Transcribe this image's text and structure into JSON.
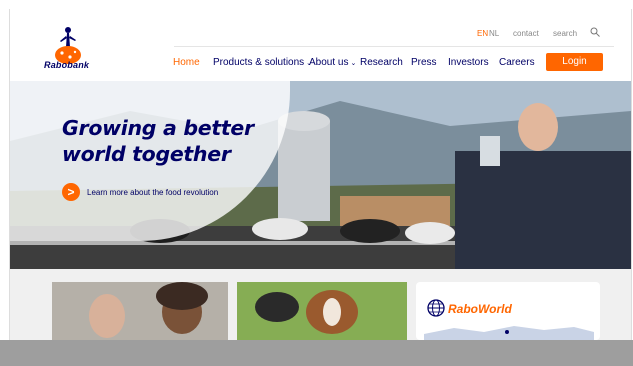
{
  "brand": {
    "name": "Rabobank",
    "accent": "#ff6600",
    "navy": "#000066"
  },
  "utility": {
    "lang_en": "EN",
    "lang_nl": "NL",
    "contact": "contact",
    "search": "search"
  },
  "nav": {
    "items": [
      {
        "label": "Home",
        "active": true
      },
      {
        "label": "Products & solutions",
        "dropdown": true
      },
      {
        "label": "About us",
        "dropdown": true
      },
      {
        "label": "Research"
      },
      {
        "label": "Press"
      },
      {
        "label": "Investors"
      },
      {
        "label": "Careers"
      }
    ],
    "login_label": "Login",
    "caret": "⌄"
  },
  "hero": {
    "title": "Growing a better world together",
    "cta_icon": ">",
    "cta_text": "Learn more about the food revolution"
  },
  "cards": {
    "raboworld_label": "RaboWorld"
  }
}
